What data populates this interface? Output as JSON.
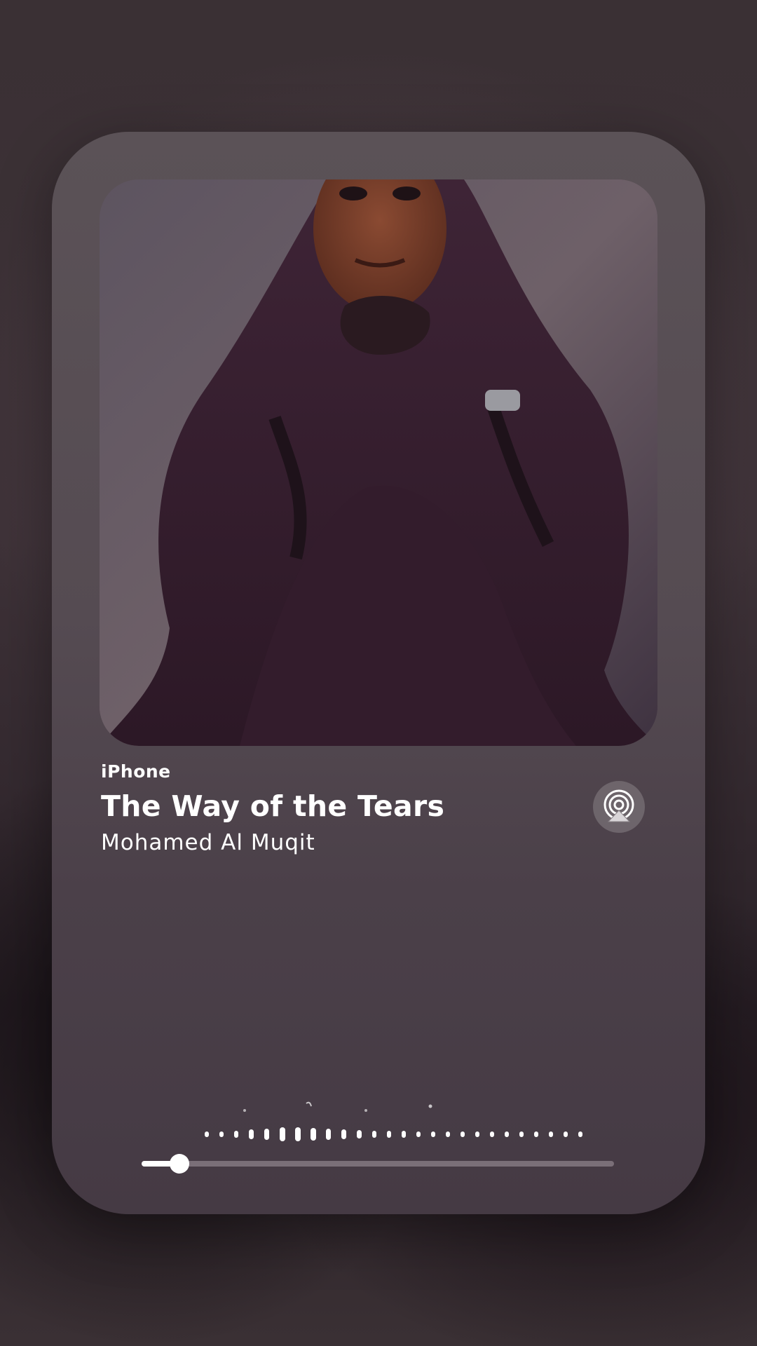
{
  "now_playing": {
    "source": "iPhone",
    "title": "The Way of the Tears",
    "artist": "Mohamed Al Muqit",
    "progress": 0.08
  },
  "icons": {
    "airplay": "airplay-icon",
    "rewind": "rewind-icon",
    "pause": "pause-icon",
    "forward": "fast-forward-icon"
  },
  "colors": {
    "card": "#554b52",
    "text": "#ffffff",
    "accent": "#ffffff"
  }
}
